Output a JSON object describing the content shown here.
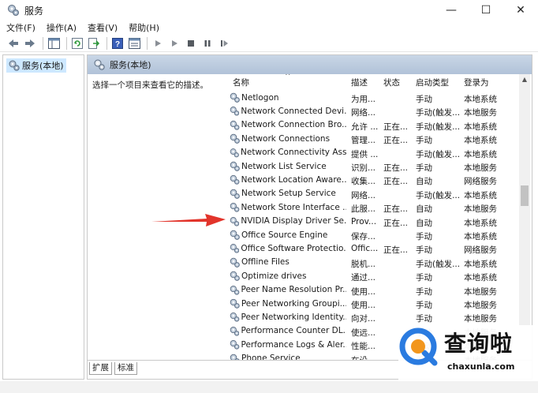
{
  "window": {
    "title": "服务",
    "controls": {
      "minimize": "—",
      "maximize": "☐",
      "close": "✕"
    }
  },
  "menu": [
    "文件(F)",
    "操作(A)",
    "查看(V)",
    "帮助(H)"
  ],
  "tree": {
    "root": "服务(本地)"
  },
  "pane": {
    "title": "服务(本地)",
    "description": "选择一个项目来查看它的描述。"
  },
  "columns": {
    "name": "名称",
    "description": "描述",
    "status": "状态",
    "startup": "启动类型",
    "logon": "登录为"
  },
  "rows": [
    {
      "name": "Netlogon",
      "desc": "为用...",
      "status": "",
      "startup": "手动",
      "logon": "本地系统"
    },
    {
      "name": "Network Connected Devi...",
      "desc": "网络...",
      "status": "",
      "startup": "手动(触发...",
      "logon": "本地服务"
    },
    {
      "name": "Network Connection Bro...",
      "desc": "允许 ...",
      "status": "正在...",
      "startup": "手动(触发...",
      "logon": "本地系统"
    },
    {
      "name": "Network Connections",
      "desc": "管理...",
      "status": "正在...",
      "startup": "手动",
      "logon": "本地系统"
    },
    {
      "name": "Network Connectivity Ass...",
      "desc": "提供 ...",
      "status": "",
      "startup": "手动(触发...",
      "logon": "本地系统"
    },
    {
      "name": "Network List Service",
      "desc": "识别...",
      "status": "正在...",
      "startup": "手动",
      "logon": "本地服务"
    },
    {
      "name": "Network Location Aware...",
      "desc": "收集...",
      "status": "正在...",
      "startup": "自动",
      "logon": "网络服务"
    },
    {
      "name": "Network Setup Service",
      "desc": "网络...",
      "status": "",
      "startup": "手动(触发...",
      "logon": "本地系统"
    },
    {
      "name": "Network Store Interface ...",
      "desc": "此服...",
      "status": "正在...",
      "startup": "自动",
      "logon": "本地服务"
    },
    {
      "name": "NVIDIA Display Driver Se...",
      "desc": "Prov...",
      "status": "正在...",
      "startup": "自动",
      "logon": "本地系统"
    },
    {
      "name": "Office  Source Engine",
      "desc": "保存...",
      "status": "",
      "startup": "手动",
      "logon": "本地系统"
    },
    {
      "name": "Office Software Protectio...",
      "desc": "Offic...",
      "status": "正在...",
      "startup": "手动",
      "logon": "网络服务"
    },
    {
      "name": "Offline Files",
      "desc": "脱机...",
      "status": "",
      "startup": "手动(触发...",
      "logon": "本地系统"
    },
    {
      "name": "Optimize drives",
      "desc": "通过...",
      "status": "",
      "startup": "手动",
      "logon": "本地系统"
    },
    {
      "name": "Peer Name Resolution Pr...",
      "desc": "使用...",
      "status": "",
      "startup": "手动",
      "logon": "本地服务"
    },
    {
      "name": "Peer Networking Groupi...",
      "desc": "使用...",
      "status": "",
      "startup": "手动",
      "logon": "本地服务"
    },
    {
      "name": "Peer Networking Identity...",
      "desc": "向对...",
      "status": "",
      "startup": "手动",
      "logon": "本地服务"
    },
    {
      "name": "Performance Counter DL...",
      "desc": "使远...",
      "status": "",
      "startup": "手动",
      "logon": "本地服务"
    },
    {
      "name": "Performance Logs & Aler...",
      "desc": "性能...",
      "status": "",
      "startup": "手动",
      "logon": "本地服务"
    },
    {
      "name": "Phone Service",
      "desc": "在设...",
      "status": "",
      "startup": "手动",
      "logon": "本地服务"
    }
  ],
  "tabs": [
    "扩展",
    "标准"
  ],
  "watermark": {
    "title": "查询啦",
    "subtitle": "chaxunla.com"
  },
  "colors": {
    "highlight_arrow": "#e2342b",
    "header_band": "#b9c9dc",
    "watermark_blue": "#2a7be0",
    "watermark_orange": "#f2961d"
  }
}
